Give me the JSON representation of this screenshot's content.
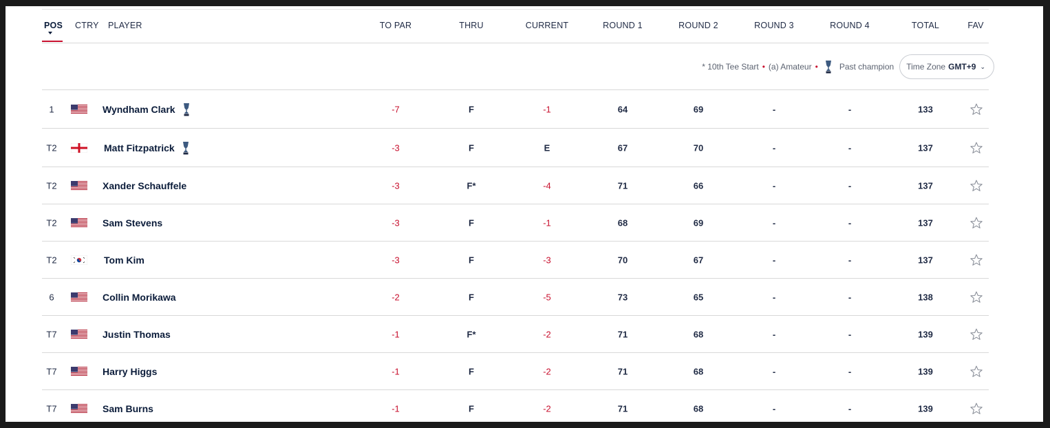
{
  "columns": {
    "pos": "POS",
    "ctry": "CTRY",
    "player": "PLAYER",
    "to_par": "TO PAR",
    "thru": "THRU",
    "current": "CURRENT",
    "round1": "ROUND 1",
    "round2": "ROUND 2",
    "round3": "ROUND 3",
    "round4": "ROUND 4",
    "total": "TOTAL",
    "fav": "FAV"
  },
  "legend": {
    "tee_start": "* 10th Tee Start",
    "amateur": "(a) Amateur",
    "past_champion": "Past champion",
    "timezone_label": "Time Zone",
    "timezone_value": "GMT+9"
  },
  "colors": {
    "accent_red": "#c8102e",
    "text_navy": "#0b1c3a"
  },
  "rows": [
    {
      "pos": "1",
      "country": "USA",
      "player": "Wyndham Clark",
      "past_champion": true,
      "to_par": "-7",
      "thru": "F",
      "current": "-1",
      "r1": "64",
      "r2": "69",
      "r3": "-",
      "r4": "-",
      "total": "133"
    },
    {
      "pos": "T2",
      "country": "ENG",
      "player": "Matt Fitzpatrick",
      "past_champion": true,
      "to_par": "-3",
      "thru": "F",
      "current": "E",
      "r1": "67",
      "r2": "70",
      "r3": "-",
      "r4": "-",
      "total": "137"
    },
    {
      "pos": "T2",
      "country": "USA",
      "player": "Xander Schauffele",
      "past_champion": false,
      "to_par": "-3",
      "thru": "F*",
      "current": "-4",
      "r1": "71",
      "r2": "66",
      "r3": "-",
      "r4": "-",
      "total": "137"
    },
    {
      "pos": "T2",
      "country": "USA",
      "player": "Sam Stevens",
      "past_champion": false,
      "to_par": "-3",
      "thru": "F",
      "current": "-1",
      "r1": "68",
      "r2": "69",
      "r3": "-",
      "r4": "-",
      "total": "137"
    },
    {
      "pos": "T2",
      "country": "KOR",
      "player": "Tom Kim",
      "past_champion": false,
      "to_par": "-3",
      "thru": "F",
      "current": "-3",
      "r1": "70",
      "r2": "67",
      "r3": "-",
      "r4": "-",
      "total": "137"
    },
    {
      "pos": "6",
      "country": "USA",
      "player": "Collin Morikawa",
      "past_champion": false,
      "to_par": "-2",
      "thru": "F",
      "current": "-5",
      "r1": "73",
      "r2": "65",
      "r3": "-",
      "r4": "-",
      "total": "138"
    },
    {
      "pos": "T7",
      "country": "USA",
      "player": "Justin Thomas",
      "past_champion": false,
      "to_par": "-1",
      "thru": "F*",
      "current": "-2",
      "r1": "71",
      "r2": "68",
      "r3": "-",
      "r4": "-",
      "total": "139"
    },
    {
      "pos": "T7",
      "country": "USA",
      "player": "Harry Higgs",
      "past_champion": false,
      "to_par": "-1",
      "thru": "F",
      "current": "-2",
      "r1": "71",
      "r2": "68",
      "r3": "-",
      "r4": "-",
      "total": "139"
    },
    {
      "pos": "T7",
      "country": "USA",
      "player": "Sam Burns",
      "past_champion": false,
      "to_par": "-1",
      "thru": "F",
      "current": "-2",
      "r1": "71",
      "r2": "68",
      "r3": "-",
      "r4": "-",
      "total": "139"
    }
  ]
}
